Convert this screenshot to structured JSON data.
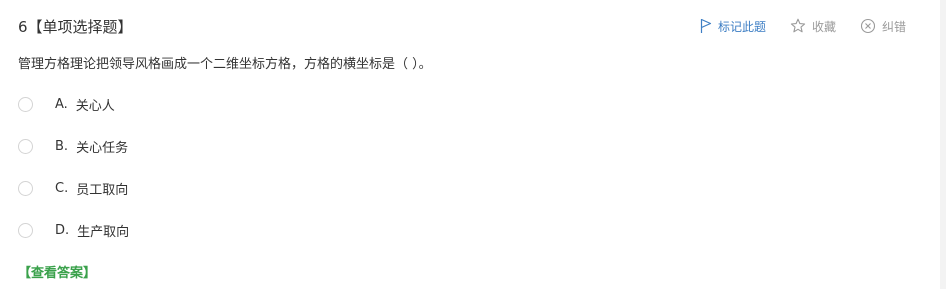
{
  "question": {
    "number_type": "6【单项选择题】",
    "stem": "管理方格理论把领导风格画成一个二维坐标方格，方格的横坐标是（   ）。"
  },
  "tools": {
    "mark_label": "标记此题",
    "favorite_label": "收藏",
    "report_label": "纠错",
    "mark_icon": "flag-icon",
    "favorite_icon": "star-icon",
    "report_icon": "circle-x-icon",
    "mark_color": "#3d7ec4",
    "muted_color": "#9a9a9a"
  },
  "options": [
    {
      "letter": "A.",
      "text": "关心人"
    },
    {
      "letter": "B.",
      "text": "关心任务"
    },
    {
      "letter": "C.",
      "text": "员工取向"
    },
    {
      "letter": "D.",
      "text": "生产取向"
    }
  ],
  "answer_link": {
    "label": "【查看答案】",
    "color": "#3aa14b"
  }
}
